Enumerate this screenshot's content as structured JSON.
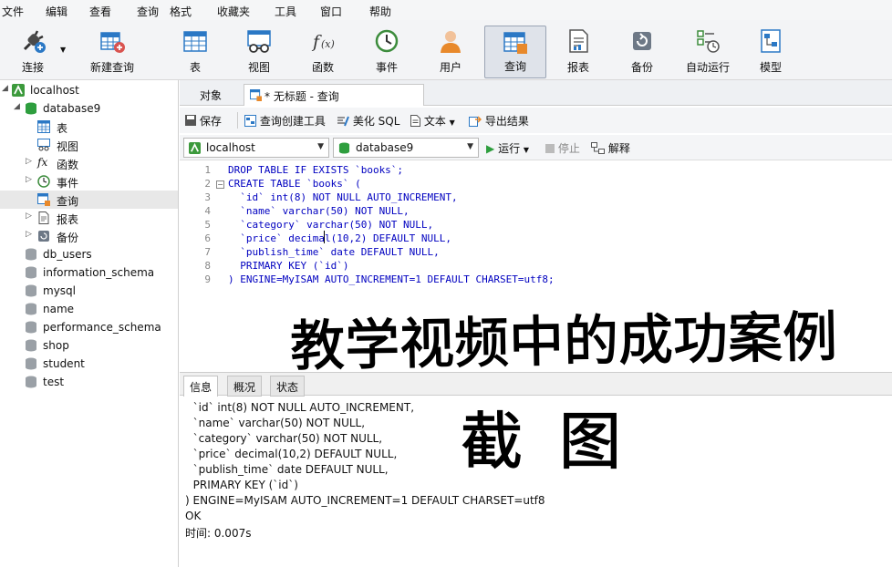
{
  "menubar": {
    "items": [
      "文件",
      "编辑",
      "查看",
      "查询",
      "格式",
      "收藏夹",
      "工具",
      "窗口",
      "帮助"
    ]
  },
  "ribbon": {
    "buttons": [
      {
        "label": "连接",
        "icon": "plug-icon"
      },
      {
        "label": "新建查询",
        "icon": "new-query-icon"
      },
      {
        "label": "表",
        "icon": "table-icon"
      },
      {
        "label": "视图",
        "icon": "view-icon"
      },
      {
        "label": "函数",
        "icon": "function-icon"
      },
      {
        "label": "事件",
        "icon": "clock-icon"
      },
      {
        "label": "用户",
        "icon": "user-icon"
      },
      {
        "label": "查询",
        "icon": "query-icon"
      },
      {
        "label": "报表",
        "icon": "report-icon"
      },
      {
        "label": "备份",
        "icon": "backup-icon"
      },
      {
        "label": "自动运行",
        "icon": "schedule-icon"
      },
      {
        "label": "模型",
        "icon": "model-icon"
      }
    ],
    "active": "查询"
  },
  "sidebar": {
    "connection": "localhost",
    "database": "database9",
    "children": [
      "表",
      "视图",
      "函数",
      "事件",
      "查询",
      "报表",
      "备份"
    ],
    "selected": "查询",
    "other_databases": [
      "db_users",
      "information_schema",
      "mysql",
      "name",
      "performance_schema",
      "shop",
      "student",
      "test"
    ]
  },
  "tabs": {
    "object": "对象",
    "query": "* 无标题 - 查询"
  },
  "query_toolbar": {
    "save": "保存",
    "builder": "查询创建工具",
    "beautify": "美化 SQL",
    "text": "文本",
    "export": "导出结果"
  },
  "run_toolbar": {
    "connection": "localhost",
    "database": "database9",
    "run": "运行",
    "stop": "停止",
    "explain": "解释"
  },
  "editor": {
    "line_numbers": [
      "1",
      "2",
      "3",
      "4",
      "5",
      "6",
      "7",
      "8",
      "9"
    ],
    "lines": [
      "DROP TABLE IF EXISTS `books`;",
      "CREATE TABLE `books` (",
      "  `id` int(8) NOT NULL AUTO_INCREMENT,",
      "  `name` varchar(50) NOT NULL,",
      "  `category` varchar(50) NOT NULL,",
      "  `price` decimal(10,2) DEFAULT NULL,",
      "  `publish_time` date DEFAULT NULL,",
      "  PRIMARY KEY (`id`)",
      ") ENGINE=MyISAM AUTO_INCREMENT=1 DEFAULT CHARSET=utf8;"
    ]
  },
  "result_tabs": [
    "信息",
    "概况",
    "状态"
  ],
  "info": {
    "lines": [
      "  `id` int(8) NOT NULL AUTO_INCREMENT,",
      "  `name` varchar(50) NOT NULL,",
      "  `category` varchar(50) NOT NULL,",
      "  `price` decimal(10,2) DEFAULT NULL,",
      "  `publish_time` date DEFAULT NULL,",
      "  PRIMARY KEY (`id`)",
      ") ENGINE=MyISAM AUTO_INCREMENT=1 DEFAULT CHARSET=utf8",
      "OK",
      "时间: 0.007s"
    ]
  },
  "annotation": {
    "line1": "教学视频中的成功案例",
    "line2": "截图"
  },
  "colors": {
    "keyword": "#0000c0",
    "accent": "#2b78c5",
    "db_green": "#2e9e3e"
  }
}
